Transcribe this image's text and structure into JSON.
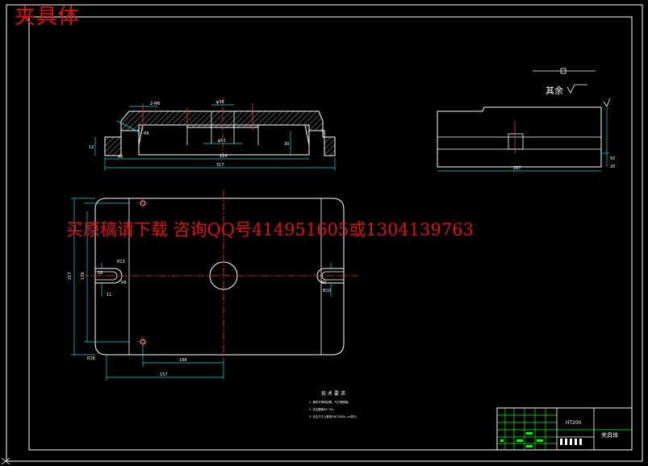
{
  "title": "夹具体",
  "watermark": "买原稿请下载 咨询QQ号414951605或1304139763",
  "roughness_note": "其余",
  "colors": {
    "background": "#000000",
    "outline": "#ffffff",
    "dimension": "#00e0e0",
    "centerline": "#ff3030",
    "hatch": "#ffffff",
    "titleblock": "#00ff00"
  },
  "front_view": {
    "labels": {
      "thread": "2-M6",
      "hole": "φ30",
      "radius": "R6",
      "dia": "φ53",
      "height_left": "12",
      "height_right": "30",
      "offset": "46",
      "width_inner": "224",
      "width_total": "317"
    }
  },
  "side_view": {
    "labels": {
      "width": "287",
      "height": "50",
      "thickness": "20"
    }
  },
  "top_view": {
    "labels": {
      "height_total": "217",
      "height_inner": "176",
      "slot_top": "R13",
      "slot_bottom": "11",
      "slot_left": "18",
      "slot_r": "R8",
      "slot_right": "B10",
      "slot_right2": "30",
      "corner": "R18",
      "offset_inner": "188",
      "offset_total": "157"
    }
  },
  "tech_requirements": {
    "heading": "技术要求",
    "lines": [
      "1. 铸件不得有砂眼、气孔等缺陷。",
      "2. 未注圆角R3~R5。",
      "3. 未注尺寸公差按GB/T1804—m执行。"
    ]
  },
  "title_block": {
    "material": "HT200",
    "part_name": "夹具体"
  }
}
